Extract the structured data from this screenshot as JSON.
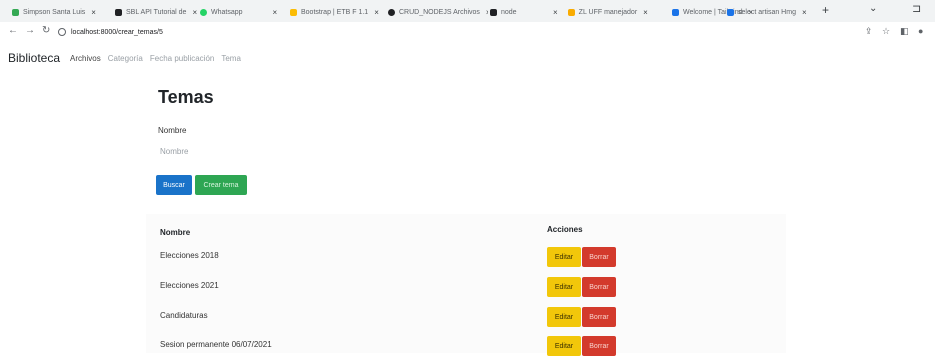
{
  "browser": {
    "tabs": [
      {
        "label": "Simpson Santa Luis",
        "color": "#34a853"
      },
      {
        "label": "SBL API Tutorial de",
        "color": "#202124"
      },
      {
        "label": "Whatsapp",
        "color": "#25d366"
      },
      {
        "label": "Bootstrap | ETB F 1.1",
        "color": "#fbbc04"
      },
      {
        "label": "CRUD_NODEJS Archivos",
        "color": "#202124"
      },
      {
        "label": "node",
        "color": "#202124"
      },
      {
        "label": "ZL UFF manejador",
        "color": "#f9ab00"
      },
      {
        "label": "Welcome | Tailwind",
        "color": "#1a73e8"
      },
      {
        "label": "select artisan Hmg",
        "color": "#1a73e8"
      }
    ],
    "url": "localhost:8000/crear_temas/5"
  },
  "app": {
    "brand": "Biblioteca",
    "nav": [
      {
        "label": "Archivos",
        "state": "active"
      },
      {
        "label": "Categoría",
        "state": "muted"
      },
      {
        "label": "Fecha publicación",
        "state": "muted"
      },
      {
        "label": "Tema",
        "state": "muted"
      }
    ]
  },
  "page": {
    "title": "Temas",
    "field_label": "Nombre",
    "field_placeholder": "Nombre",
    "search_button": "Buscar",
    "add_button": "Crear tema"
  },
  "table": {
    "headers": {
      "name": "Nombre",
      "actions": "Acciones"
    },
    "edit_label": "Editar",
    "delete_label": "Borrar",
    "rows": [
      {
        "name": "Elecciones 2018"
      },
      {
        "name": "Elecciones 2021"
      },
      {
        "name": "Candidaturas"
      },
      {
        "name": "Sesion permanente 06/07/2021"
      }
    ]
  },
  "colors": {
    "search_button": "#1a73c9",
    "add_button": "#2ea653",
    "edit_button": "#f2c70a",
    "delete_button": "#d33a2c"
  },
  "icons": {
    "back": "arrow-left-icon",
    "forward": "arrow-right-icon",
    "reload": "reload-icon",
    "new_tab": "plus-icon"
  }
}
